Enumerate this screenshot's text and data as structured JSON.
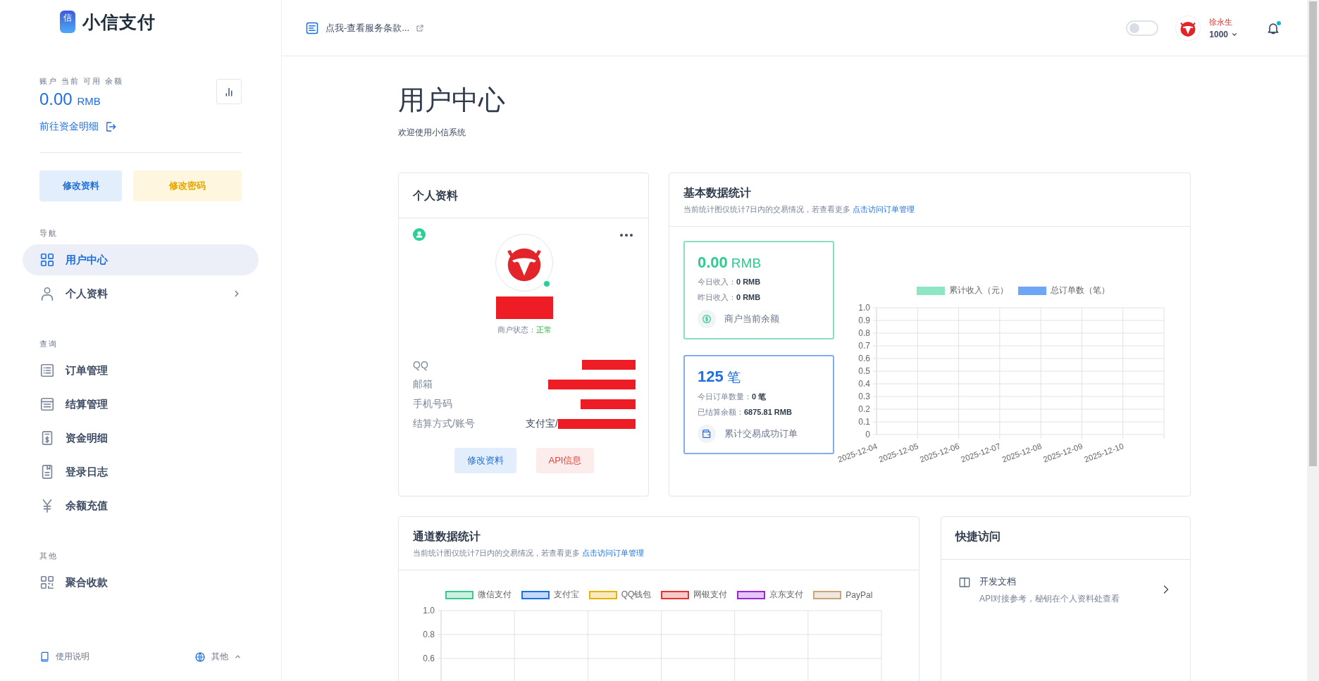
{
  "brand": {
    "logo_glyph": "信",
    "name": "小信支付"
  },
  "balance": {
    "label": "账户 当前 可用 余额",
    "amount": "0.00",
    "unit": "RMB",
    "link": "前往资金明细"
  },
  "sidebar_buttons": [
    {
      "label": "修改资料",
      "kind": "primary"
    },
    {
      "label": "修改密码",
      "kind": "warning"
    }
  ],
  "nav_sections": [
    {
      "title": "导航",
      "items": [
        {
          "label": "用户中心",
          "kind": "grid",
          "selected": true,
          "has_submenu": false
        },
        {
          "label": "个人资料",
          "kind": "user",
          "selected": false,
          "has_submenu": true
        }
      ]
    },
    {
      "title": "查询",
      "items": [
        {
          "label": "订单管理",
          "kind": "list",
          "selected": false,
          "has_submenu": false
        },
        {
          "label": "结算管理",
          "kind": "form",
          "selected": false,
          "has_submenu": false
        },
        {
          "label": "资金明细",
          "kind": "receipt",
          "selected": false,
          "has_submenu": false
        },
        {
          "label": "登录日志",
          "kind": "log",
          "selected": false,
          "has_submenu": false
        },
        {
          "label": "余额充值",
          "kind": "yen",
          "selected": false,
          "has_submenu": false
        }
      ]
    },
    {
      "title": "其他",
      "items": [
        {
          "label": "聚合收款",
          "kind": "qr",
          "selected": false,
          "has_submenu": false
        }
      ]
    }
  ],
  "sidebar_footer": {
    "help": "使用说明",
    "language": "其他"
  },
  "topbar": {
    "notice": "点我-查看服务条款...",
    "dark_mode": {
      "on": false
    },
    "user": {
      "name": "徐永生",
      "balance": "1000"
    },
    "notifications": {
      "unread": true
    }
  },
  "page": {
    "title": "用户中心",
    "subtitle": "欢迎使用小信系统"
  },
  "profile": {
    "title": "个人资料",
    "name_redacted": true,
    "online": true,
    "status_label": "商户状态：",
    "status": "正常",
    "fields": [
      {
        "label": "QQ",
        "redacted": true
      },
      {
        "label": "邮箱",
        "redacted": true
      },
      {
        "label": "手机号码",
        "redacted": true
      },
      {
        "label": "结算方式/账号",
        "value": "支付宝/",
        "redacted": true
      }
    ],
    "buttons": [
      {
        "label": "修改资料",
        "kind": "primary"
      },
      {
        "label": "API信息",
        "kind": "danger"
      }
    ]
  },
  "basic_stats": {
    "title": "基本数据统计",
    "note": "当前统计图仅统计7日内的交易情况，若查看更多",
    "link": "点击访问订单管理",
    "tiles": [
      {
        "kind": "income",
        "value": "0.00",
        "unit": "RMB",
        "lines": [
          {
            "label": "今日收入：",
            "value": "0 RMB"
          },
          {
            "label": "昨日收入：",
            "value": "0 RMB"
          }
        ],
        "caption": "商户当前余额"
      },
      {
        "kind": "orders",
        "value": "125",
        "unit": "笔",
        "lines": [
          {
            "label": "今日订单数量：",
            "value": "0 笔"
          },
          {
            "label": "已结算余额：",
            "value": "6875.81 RMB"
          }
        ],
        "caption": "累计交易成功订单"
      }
    ],
    "chart_data": {
      "type": "bar",
      "categories": [
        "2025-12-04",
        "2025-12-05",
        "2025-12-06",
        "2025-12-07",
        "2025-12-08",
        "2025-12-09",
        "2025-12-10"
      ],
      "series": [
        {
          "name": "累计收入（元）",
          "color": "#8de6c4",
          "values": [
            null,
            null,
            null,
            null,
            null,
            null,
            null
          ]
        },
        {
          "name": "总订单数（笔）",
          "color": "#6ea6f6",
          "values": [
            null,
            null,
            null,
            null,
            null,
            null,
            null
          ]
        }
      ],
      "grid": true,
      "ylim": [
        0,
        1
      ],
      "yticks": [
        0,
        0.1,
        0.2,
        0.3,
        0.4,
        0.5,
        0.6,
        0.7,
        0.8,
        0.9,
        {
          "value": 1,
          "label": "1.0"
        }
      ]
    }
  },
  "channel_stats": {
    "title": "通道数据统计",
    "note": "当前统计图仅统计7日内的交易情况，若查看更多",
    "link": "点击访问订单管理",
    "chart_data": {
      "type": "bar",
      "series": [
        {
          "name": "微信支付",
          "color": "#3cc98f"
        },
        {
          "name": "支付宝",
          "color": "#1e6fe0"
        },
        {
          "name": "QQ钱包",
          "color": "#e8b20c"
        },
        {
          "name": "网银支付",
          "color": "#e03535"
        },
        {
          "name": "京东支付",
          "color": "#9b27d8"
        },
        {
          "name": "PayPal",
          "color": "#c9a67a"
        }
      ],
      "grid": true,
      "ylim": [
        0,
        1
      ],
      "yticks": [
        0.6,
        0.8,
        {
          "value": 1,
          "label": "1.0"
        }
      ]
    }
  },
  "quick_access": {
    "title": "快捷访问",
    "items": [
      {
        "title": "开发文档",
        "description": "API对接参考，秘钥在个人资料处查看"
      }
    ]
  }
}
